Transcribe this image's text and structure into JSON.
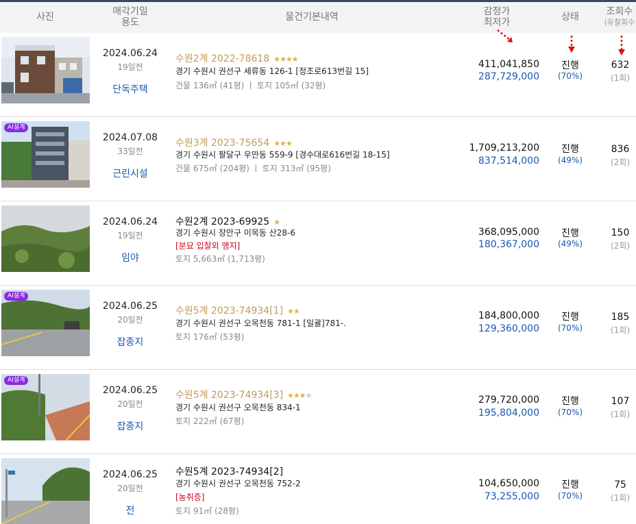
{
  "header": {
    "photo": "사진",
    "date_line1": "매각기일",
    "date_line2": "용도",
    "info": "물건기본내역",
    "price_line1": "감정가",
    "price_line2": "최저가",
    "status": "상태",
    "views_line1": "조회수",
    "views_line2": "(유찰회수"
  },
  "colors": {
    "accent_blue": "#1a56b0",
    "gold": "#c29a58",
    "red": "#d0021b",
    "ai_badge": "#8a2be2"
  },
  "rows": [
    {
      "date": "2024.06.24",
      "days": "19일전",
      "use": "단독주택",
      "case_no": "수원2계 2022-78618",
      "stars_on": 4,
      "stars_off": 0,
      "addr": "경기 수원시 권선구 세류동 126-1 [정조로613번길 15]",
      "tag": "",
      "area": "건물 136㎡ (41평)  ㅣ  토지 105㎡ (32평)",
      "appraisal": "411,041,850",
      "minimum": "287,729,000",
      "status": "진행",
      "rate": "(70%)",
      "views": "632",
      "fails": "(1회)",
      "ai": ""
    },
    {
      "date": "2024.07.08",
      "days": "33일전",
      "use": "근린시설",
      "case_no": "수원3계 2023-75654",
      "stars_on": 3,
      "stars_off": 0,
      "addr": "경기 수원시 팔달구 우만동 559-9 [경수대로616번길 18-15]",
      "tag": "",
      "area": "건물 675㎡ (204평)  ㅣ  토지 313㎡ (95평)",
      "appraisal": "1,709,213,200",
      "minimum": "837,514,000",
      "status": "진행",
      "rate": "(49%)",
      "views": "836",
      "fails": "(2회)",
      "ai": "AI설계"
    },
    {
      "date": "2024.06.24",
      "days": "19일전",
      "use": "임야",
      "case_no": "수원2계 2023-69925",
      "stars_on": 1,
      "stars_off": 0,
      "addr": "경기 수원시 장안구 이목동 산28-6",
      "tag": "[분묘  입찰외  맹지]",
      "area": "토지 5,663㎡ (1,713평)",
      "appraisal": "368,095,000",
      "minimum": "180,367,000",
      "status": "진행",
      "rate": "(49%)",
      "views": "150",
      "fails": "(2회)",
      "ai": ""
    },
    {
      "date": "2024.06.25",
      "days": "20일전",
      "use": "잡종지",
      "case_no": "수원5계 2023-74934[1]",
      "stars_on": 2,
      "stars_off": 0,
      "addr": "경기 수원시 권선구 오목천동 781-1  [일괄]781-.",
      "tag": "",
      "area": "토지 176㎡ (53평)",
      "appraisal": "184,800,000",
      "minimum": "129,360,000",
      "status": "진행",
      "rate": "(70%)",
      "views": "185",
      "fails": "(1회)",
      "ai": "AI설계"
    },
    {
      "date": "2024.06.25",
      "days": "20일전",
      "use": "잡종지",
      "case_no": "수원5계 2023-74934[3]",
      "stars_on": 3,
      "stars_off": 1,
      "addr": "경기 수원시 권선구 오목천동 834-1",
      "tag": "",
      "area": "토지 222㎡ (67평)",
      "appraisal": "279,720,000",
      "minimum": "195,804,000",
      "status": "진행",
      "rate": "(70%)",
      "views": "107",
      "fails": "(1회)",
      "ai": "AI설계"
    },
    {
      "date": "2024.06.25",
      "days": "20일전",
      "use": "전",
      "case_no": "수원5계 2023-74934[2]",
      "stars_on": 0,
      "stars_off": 0,
      "addr": "경기 수원시 권선구 오목천동 752-2",
      "tag": "[농취증]",
      "area": "토지 91㎡ (28평)",
      "appraisal": "104,650,000",
      "minimum": "73,255,000",
      "status": "진행",
      "rate": "(70%)",
      "views": "75",
      "fails": "(1회)",
      "ai": ""
    }
  ]
}
